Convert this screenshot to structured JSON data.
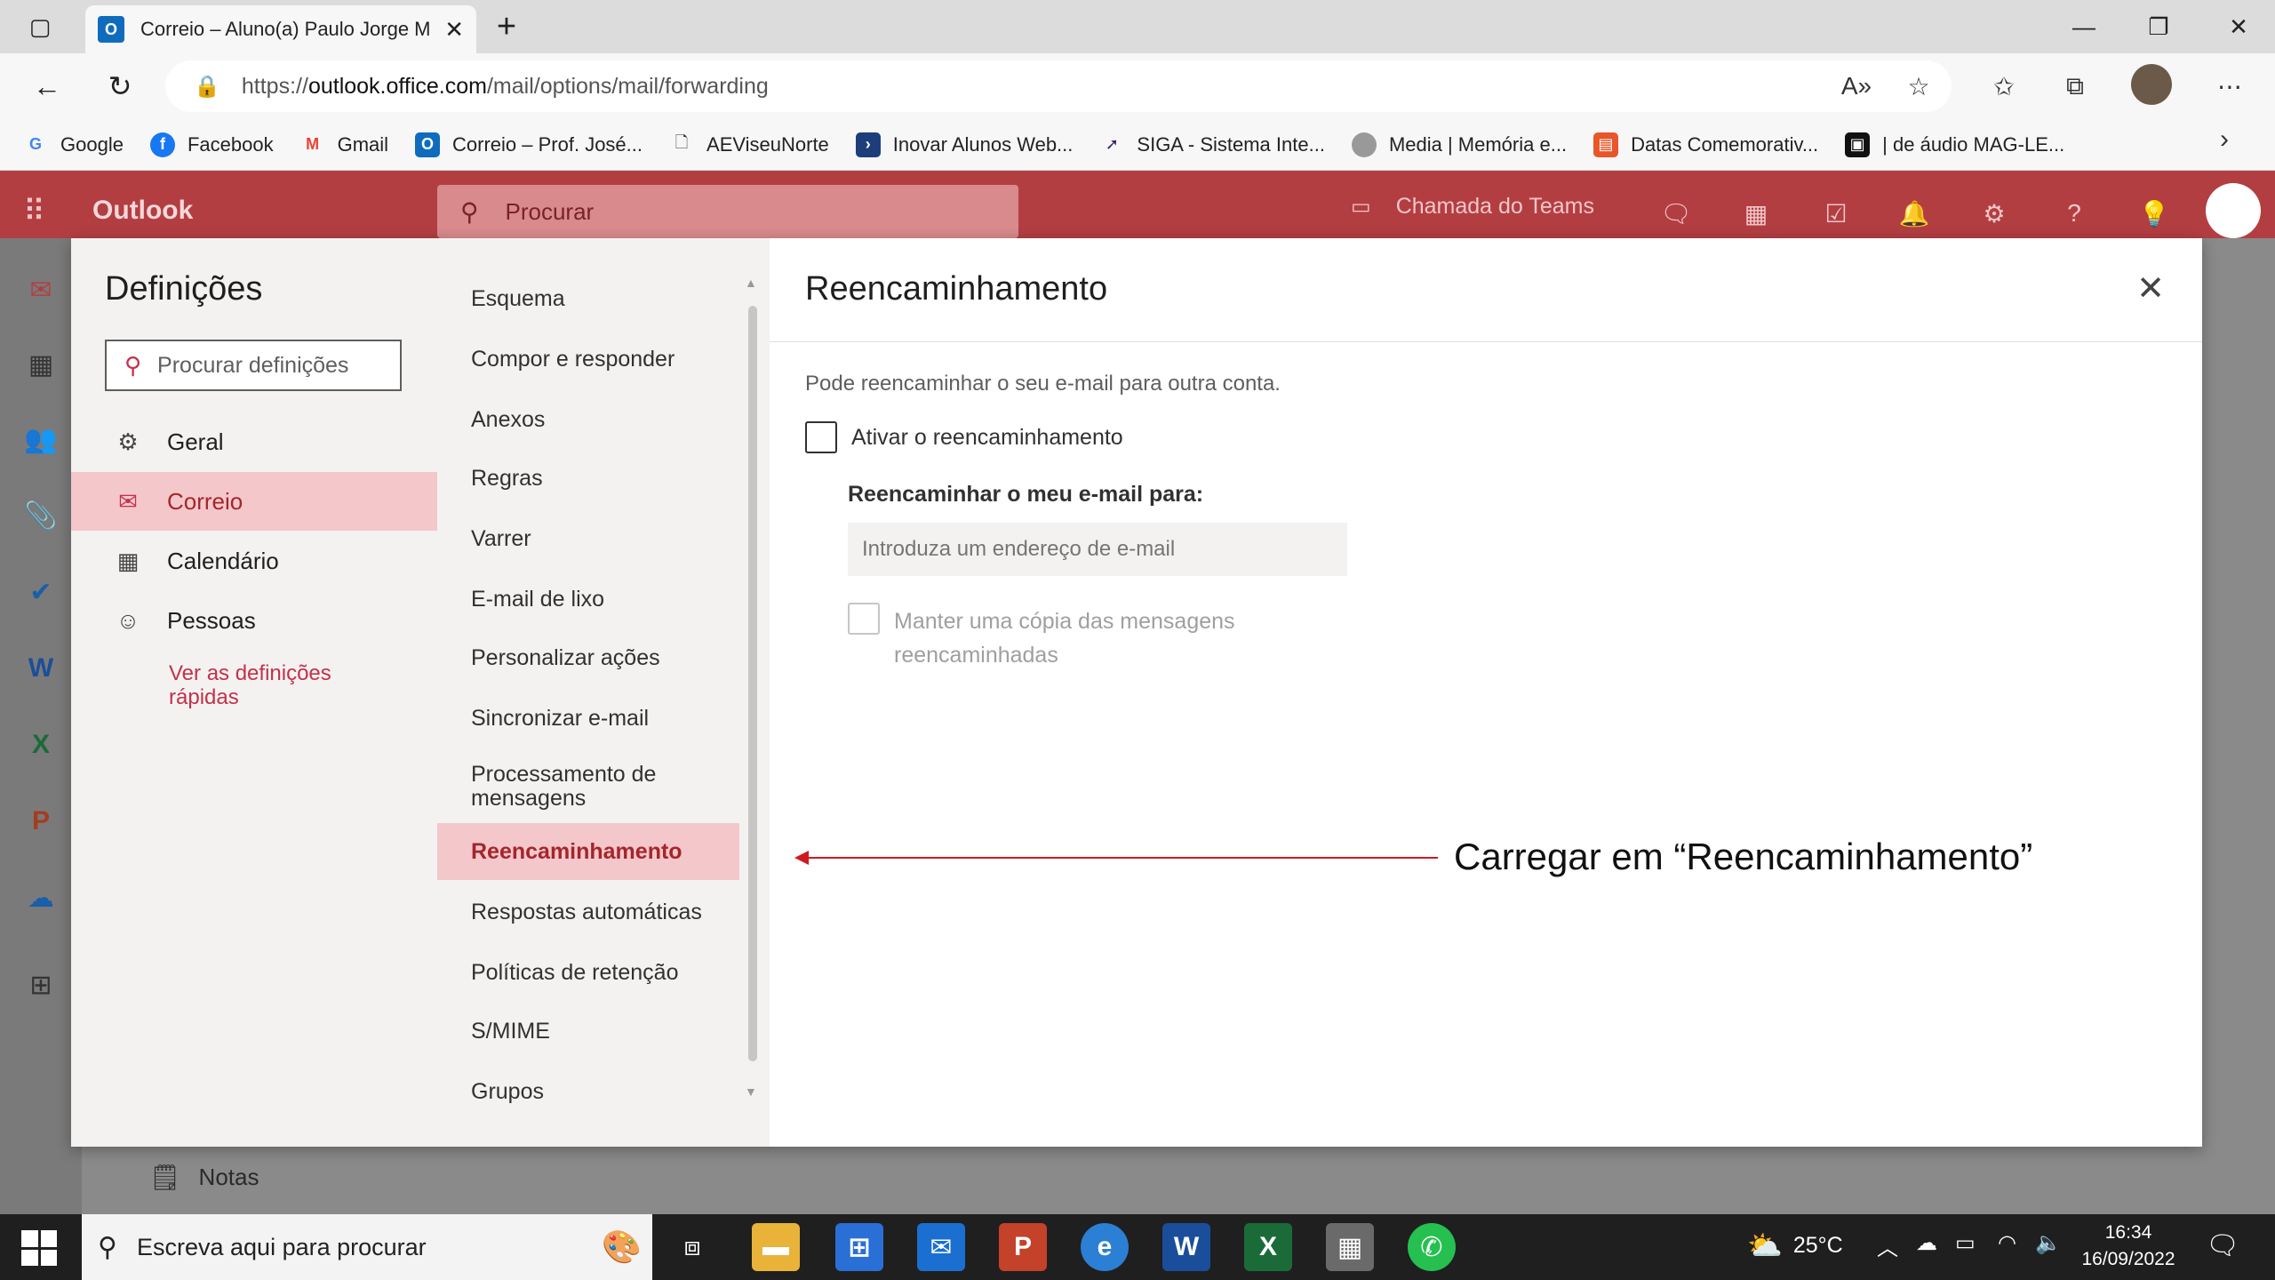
{
  "browser": {
    "tab_title": "Correio – Aluno(a) Paulo Jorge M",
    "url_prefix": "https://",
    "url_host": "outlook.office.com",
    "url_path": "/mail/options/mail/forwarding",
    "bookmarks": [
      {
        "label": "Google",
        "icon": "google-icon",
        "color": "#ffffff"
      },
      {
        "label": "Facebook",
        "icon": "facebook-icon",
        "color": "#1877f2"
      },
      {
        "label": "Gmail",
        "icon": "gmail-icon",
        "color": "#ea4335"
      },
      {
        "label": "Correio – Prof. José...",
        "icon": "outlook-icon",
        "color": "#0f6cbd"
      },
      {
        "label": "AEViseuNorte",
        "icon": "page-icon",
        "color": "#ffffff"
      },
      {
        "label": "Inovar Alunos Web...",
        "icon": "inovar-icon",
        "color": "#1d3e7a"
      },
      {
        "label": "SIGA - Sistema Inte...",
        "icon": "siga-icon",
        "color": "#3a1a6b"
      },
      {
        "label": "Media | Memória e...",
        "icon": "media-icon",
        "color": "#888888"
      },
      {
        "label": "Datas Comemorativ...",
        "icon": "calendar-icon",
        "color": "#e8562a"
      },
      {
        "label": "| de áudio MAG-LE...",
        "icon": "audio-icon",
        "color": "#111111"
      }
    ]
  },
  "outlook": {
    "brand": "Outlook",
    "search_placeholder": "Procurar",
    "teams_call": "Chamada do Teams",
    "notes": "Notas",
    "accent": "#b33e42"
  },
  "settings": {
    "title": "Definições",
    "search_placeholder": "Procurar definições",
    "categories": [
      {
        "label": "Geral",
        "icon": "gear-icon",
        "active": false
      },
      {
        "label": "Correio",
        "icon": "mail-icon",
        "active": true
      },
      {
        "label": "Calendário",
        "icon": "calendar-icon",
        "active": false
      },
      {
        "label": "Pessoas",
        "icon": "people-icon",
        "active": false
      }
    ],
    "quick_settings_link": "Ver as definições rápidas",
    "mail_sections": [
      {
        "label": "Esquema",
        "active": false
      },
      {
        "label": "Compor e responder",
        "active": false
      },
      {
        "label": "Anexos",
        "active": false
      },
      {
        "label": "Regras",
        "active": false
      },
      {
        "label": "Varrer",
        "active": false
      },
      {
        "label": "E-mail de lixo",
        "active": false
      },
      {
        "label": "Personalizar ações",
        "active": false
      },
      {
        "label": "Sincronizar e-mail",
        "active": false
      },
      {
        "label": "Processamento de mensagens",
        "active": false
      },
      {
        "label": "Reencaminhamento",
        "active": true
      },
      {
        "label": "Respostas automáticas",
        "active": false
      },
      {
        "label": "Políticas de retenção",
        "active": false
      },
      {
        "label": "S/MIME",
        "active": false
      },
      {
        "label": "Grupos",
        "active": false
      }
    ],
    "pane": {
      "title": "Reencaminhamento",
      "description": "Pode reencaminhar o seu e-mail para outra conta.",
      "enable_label": "Ativar o reencaminhamento",
      "enable_checked": false,
      "forward_to_label": "Reencaminhar o meu e-mail para:",
      "forward_to_placeholder": "Introduza um endereço de e-mail",
      "keep_copy_label": "Manter uma cópia das mensagens reencaminhadas",
      "keep_copy_checked": false
    }
  },
  "annotation": {
    "text": "Carregar em “Reencaminhamento”",
    "color": "#d0191f"
  },
  "taskbar": {
    "search_placeholder": "Escreva aqui para procurar",
    "temperature": "25°C",
    "time": "16:34",
    "date": "16/09/2022"
  }
}
